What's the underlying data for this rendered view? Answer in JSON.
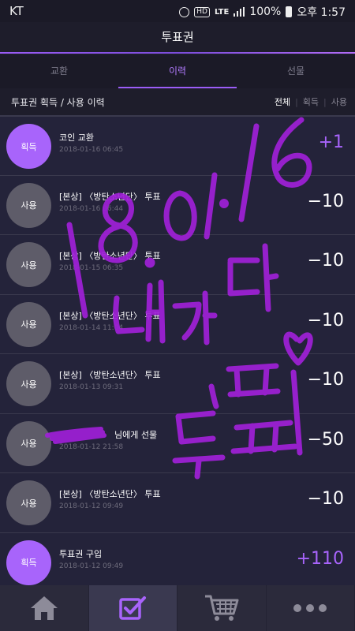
{
  "status_bar": {
    "carrier": "KT",
    "hd": "HD",
    "lte": "LTE",
    "battery": "100%",
    "time": "오후 1:57"
  },
  "header": {
    "title": "투표권"
  },
  "tabs": [
    {
      "label": "교환",
      "active": false
    },
    {
      "label": "이력",
      "active": true
    },
    {
      "label": "선물",
      "active": false
    }
  ],
  "list_header": {
    "title": "투표권 획득 / 사용 이력",
    "filters": [
      {
        "label": "전체",
        "active": true
      },
      {
        "label": "획득",
        "active": false
      },
      {
        "label": "사용",
        "active": false
      }
    ]
  },
  "history": [
    {
      "badge": "획득",
      "type": "gain",
      "title": "코인 교환",
      "date": "2018-01-16 06:45",
      "amount": "+1"
    },
    {
      "badge": "사용",
      "type": "use",
      "title": "[본상] 〈방탄소년단〉 투표",
      "date": "2018-01-16 06:44",
      "amount": "−10"
    },
    {
      "badge": "사용",
      "type": "use",
      "title": "[본상] 〈방탄소년단〉 투표",
      "date": "2018-01-15 06:35",
      "amount": "−10"
    },
    {
      "badge": "사용",
      "type": "use",
      "title": "[본상] 〈방탄소년단〉 투표",
      "date": "2018-01-14 11:04",
      "amount": "−10"
    },
    {
      "badge": "사용",
      "type": "use",
      "title": "[본상] 〈방탄소년단〉 투표",
      "date": "2018-01-13 09:31",
      "amount": "−10"
    },
    {
      "badge": "사용",
      "type": "use",
      "title": "님에게 선물",
      "date": "2018-01-12 21:58",
      "amount": "−50"
    },
    {
      "badge": "사용",
      "type": "use",
      "title": "[본상] 〈방탄소년단〉 투표",
      "date": "2018-01-12 09:49",
      "amount": "−10"
    },
    {
      "badge": "획득",
      "type": "gain",
      "title": "투표권 구입",
      "date": "2018-01-12 09:49",
      "amount": "+110"
    }
  ],
  "bottom_nav": [
    {
      "icon": "home-icon",
      "active": false
    },
    {
      "icon": "vote-check-icon",
      "active": true
    },
    {
      "icon": "cart-icon",
      "active": false
    },
    {
      "icon": "more-icon",
      "active": false
    }
  ],
  "handwriting": {
    "date": "18. 01. 16",
    "note": "내가 다 투표"
  },
  "colors": {
    "accent": "#a864fb",
    "background": "#1e1d2b",
    "row": "#24233a",
    "use_badge": "#5e5c69",
    "ink": "#a020d8"
  }
}
